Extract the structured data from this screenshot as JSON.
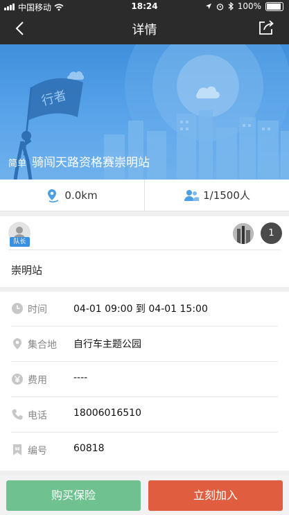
{
  "status_bar": {
    "carrier": "中国移动",
    "time": "18:24",
    "battery": "100%",
    "battery_level": 1.0
  },
  "nav": {
    "title": "详情",
    "back_icon": "chevron-left-icon",
    "share_icon": "share-icon"
  },
  "banner": {
    "flag_text": "行者",
    "tag": "简单",
    "title": "骑闯天路资格赛崇明站"
  },
  "stats": {
    "distance": "0.0km",
    "members": "1/1500人"
  },
  "team": {
    "leader_badge": "队长",
    "member_count": "1",
    "station": "崇明站"
  },
  "details": [
    {
      "icon": "clock-icon",
      "label": "时间",
      "value": "04-01 09:00 到 04-01 15:00"
    },
    {
      "icon": "location-pin-icon",
      "label": "集合地",
      "value": "自行车主题公园"
    },
    {
      "icon": "yen-icon",
      "label": "费用",
      "value": "----"
    },
    {
      "icon": "phone-icon",
      "label": "电话",
      "value": "18006016510"
    },
    {
      "icon": "bookmark-icon",
      "label": "编号",
      "value": "60818"
    }
  ],
  "buttons": {
    "insurance": "购买保险",
    "join": "立刻加入"
  },
  "colors": {
    "nav_bg": "#2b2b2b",
    "banner_blue": "#4a97e2",
    "insurance_green": "#6fc190",
    "join_orange": "#e05e3f",
    "badge_blue": "#3b8fe0"
  }
}
